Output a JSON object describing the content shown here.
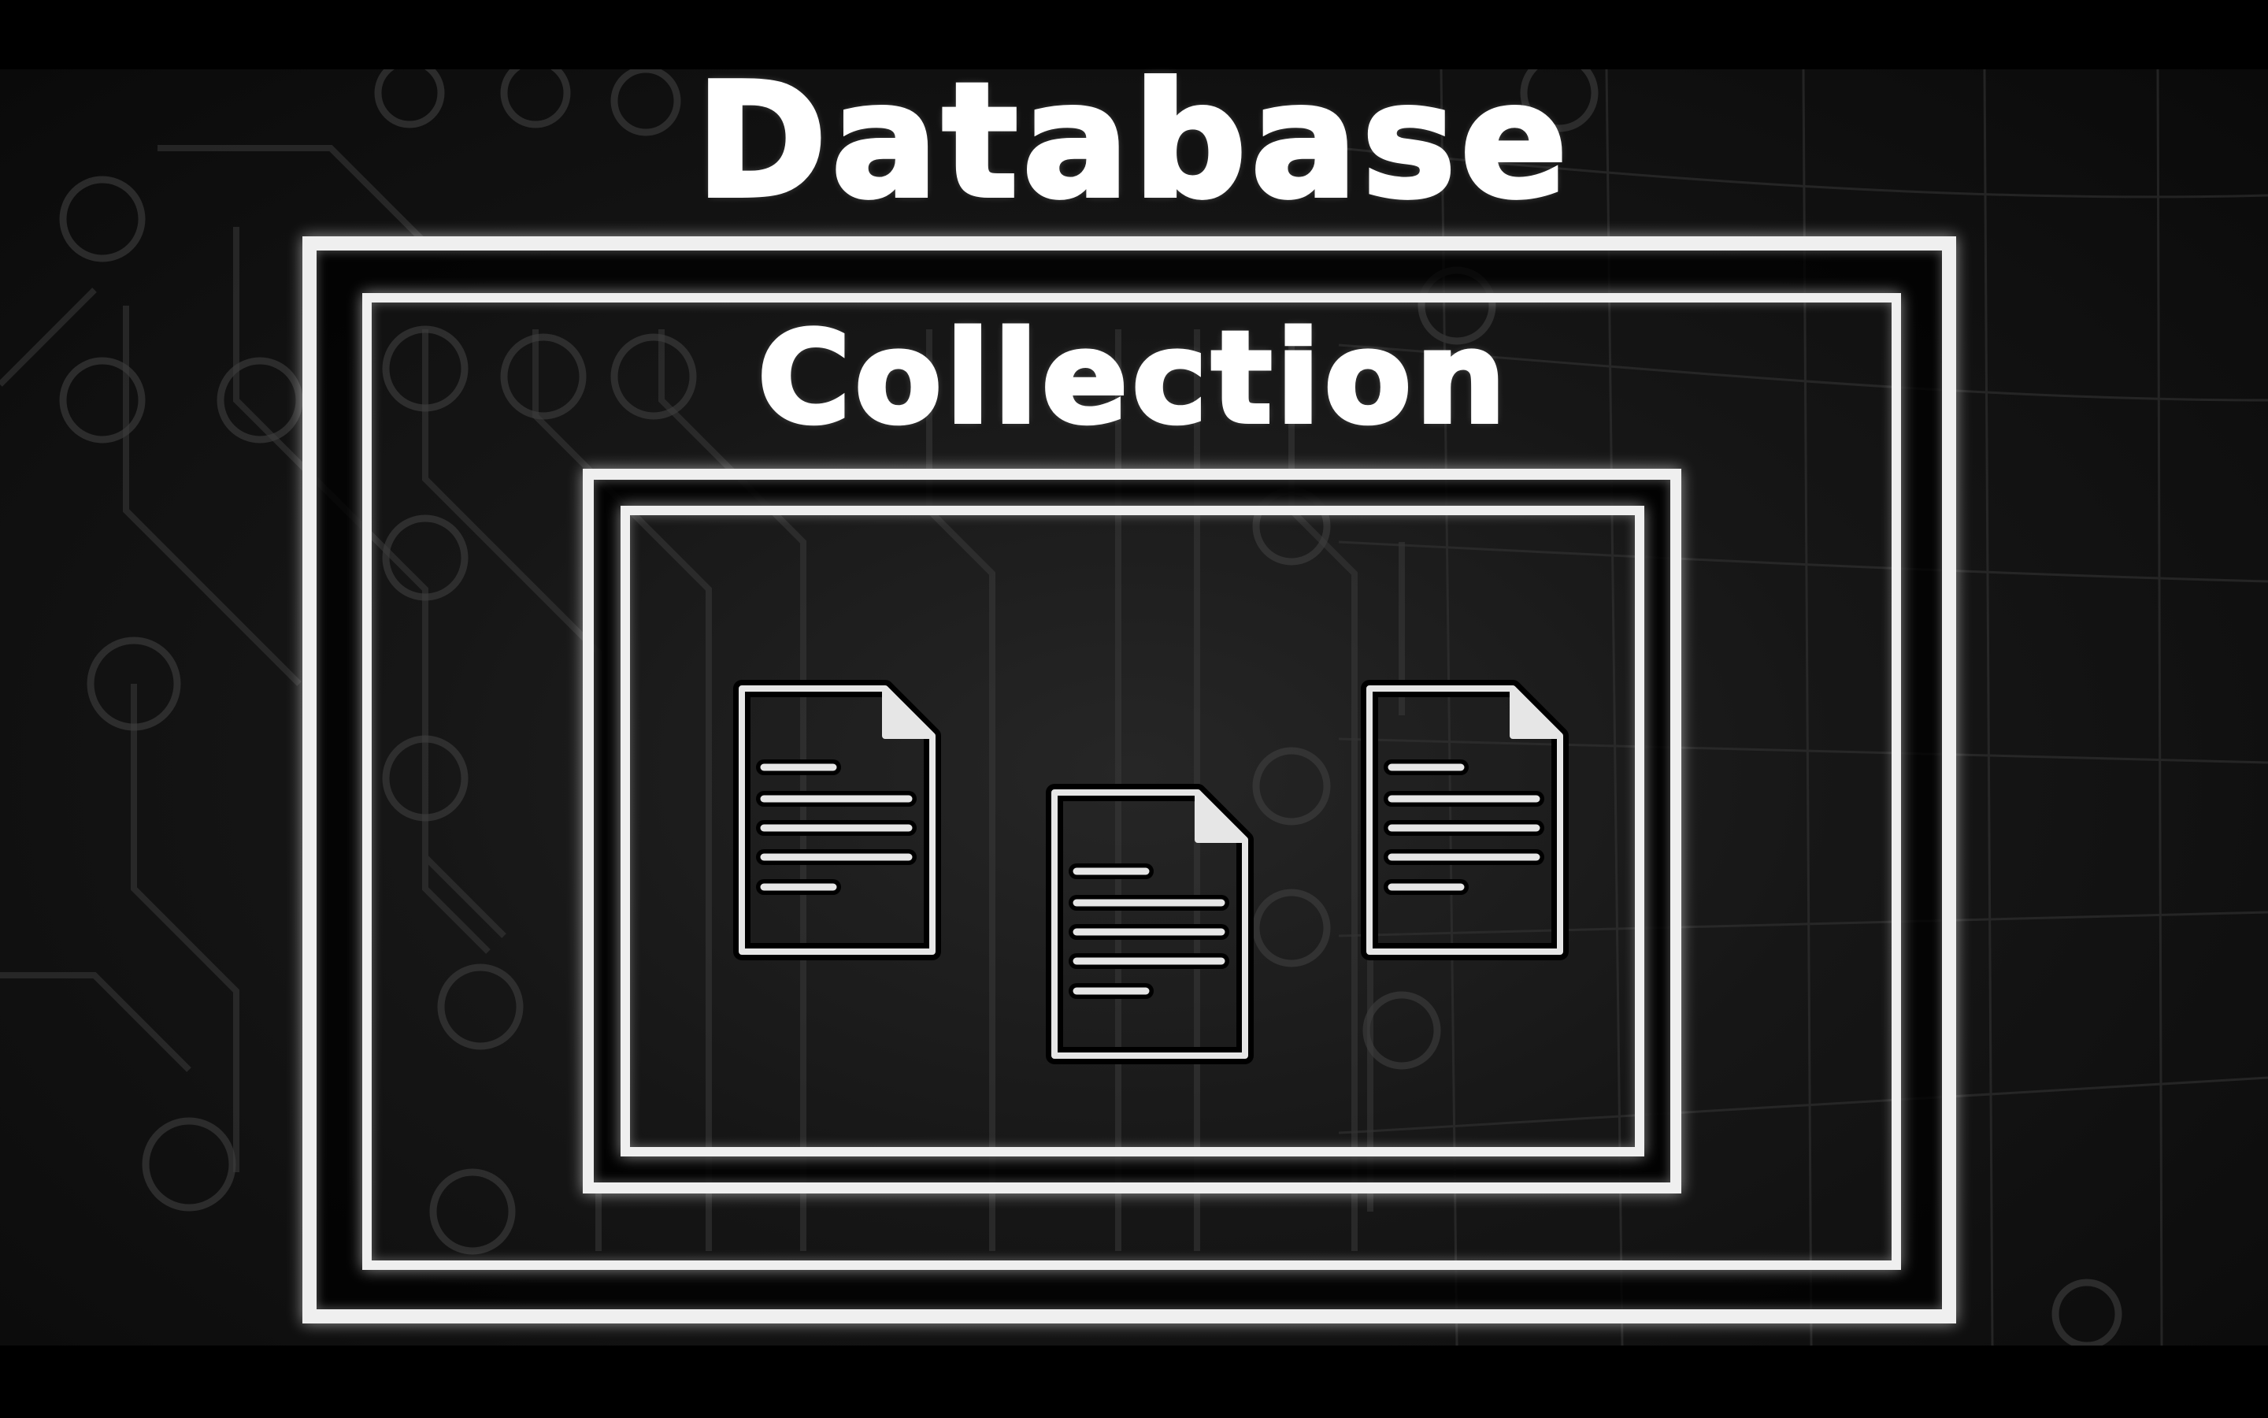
{
  "diagram": {
    "outer_label": "Database",
    "inner_label": "Collection",
    "documents": [
      {
        "icon": "document-icon"
      },
      {
        "icon": "document-icon"
      },
      {
        "icon": "document-icon"
      }
    ]
  },
  "colors": {
    "background": "#000000",
    "frame": "#efefef",
    "text": "#ffffff"
  }
}
